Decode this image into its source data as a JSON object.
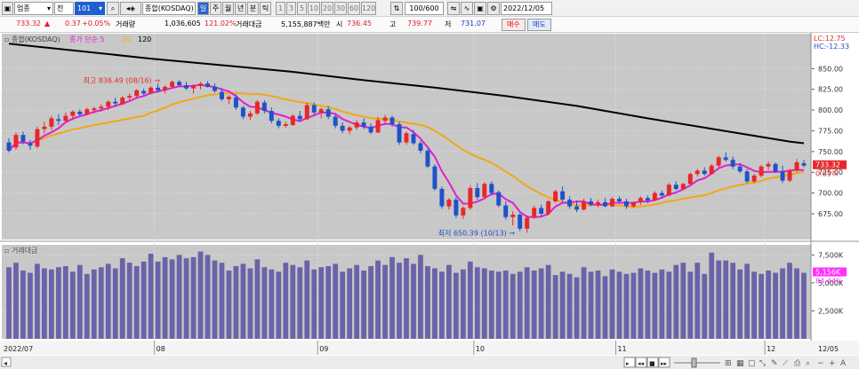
{
  "toolbar": {
    "market_type": "업종",
    "period_prefix": "전",
    "code": "101",
    "search_icon": "magnifier-icon",
    "index_name": "종합(KOSDAQ)",
    "periods": [
      "일",
      "주",
      "월",
      "년",
      "분",
      "틱"
    ],
    "selected_period": "일",
    "intervals": [
      "1",
      "3",
      "5",
      "10",
      "20",
      "30",
      "60",
      "120"
    ],
    "count": "100/600",
    "date": "2022/12/05"
  },
  "quote": {
    "price": "733.32",
    "change_arrow": "▲",
    "change": "0.37",
    "change_pct": "+0.05%",
    "volume_label": "거래량",
    "volume": "1,036,605",
    "volume_pct": "121.02%",
    "value_label": "거래대금",
    "value": "5,155,887백만",
    "open_label": "시",
    "open": "736.45",
    "high_label": "고",
    "high": "739.77",
    "low_label": "저",
    "low": "731.07",
    "buy_label": "매수",
    "sell_label": "매도"
  },
  "legend": {
    "main_title": "종합(KOSDAQ)",
    "ma_label": "종가 단순",
    "ma5": "5",
    "ma20": "20",
    "ma120": "120",
    "volume_title": "거래대금"
  },
  "annotations": {
    "high_label": "최고 836.49 (08/16)",
    "low_label": "최저 650.39 (10/13)",
    "lc": "LC:12.75",
    "hc": "HC:-12.33",
    "price_tag": "733.32",
    "price_tag_pct": "0.05%",
    "vol_tag": "5,156K",
    "vol_tag_pct": "84.44%"
  },
  "colors": {
    "up": "#e8272a",
    "down": "#1f52c8",
    "ma5": "#e020d0",
    "ma20": "#f0a818",
    "ma120": "#000000",
    "volume_bar": "#6a63a8",
    "panel_bg": "#c8c8c8"
  },
  "x_axis": {
    "labels": [
      {
        "text": "2022/07",
        "index": 0
      },
      {
        "text": "08",
        "index": 21
      },
      {
        "text": "09",
        "index": 44
      },
      {
        "text": "10",
        "index": 66
      },
      {
        "text": "11",
        "index": 86
      },
      {
        "text": "12",
        "index": 107
      },
      {
        "text": "12/05",
        "index": 112
      }
    ]
  },
  "chart_data": {
    "type": "candlestick",
    "price_axis": {
      "ticks": [
        850,
        825,
        800,
        775,
        750,
        725,
        700,
        675
      ],
      "ylim": [
        644,
        892
      ]
    },
    "volume_axis": {
      "ticks": [
        "7,500K",
        "5,000K",
        "2,500K"
      ],
      "tick_values": [
        7500,
        5000,
        2500
      ],
      "ylim": [
        0,
        8400
      ]
    },
    "ma120_points": [
      [
        0,
        880
      ],
      [
        10,
        871
      ],
      [
        20,
        862
      ],
      [
        30,
        854
      ],
      [
        40,
        846
      ],
      [
        50,
        836
      ],
      [
        60,
        827
      ],
      [
        70,
        817
      ],
      [
        80,
        805
      ],
      [
        90,
        790
      ],
      [
        100,
        776
      ],
      [
        110,
        762
      ],
      [
        112,
        760
      ]
    ],
    "candles": [
      [
        0,
        761,
        766,
        749,
        751
      ],
      [
        1,
        755,
        773,
        752,
        770
      ],
      [
        2,
        770,
        774,
        759,
        762
      ],
      [
        3,
        760,
        764,
        752,
        757
      ],
      [
        4,
        756,
        780,
        754,
        777
      ],
      [
        5,
        777,
        786,
        772,
        780
      ],
      [
        6,
        780,
        793,
        776,
        790
      ],
      [
        7,
        789,
        795,
        782,
        787
      ],
      [
        8,
        787,
        797,
        784,
        793
      ],
      [
        9,
        793,
        800,
        788,
        798
      ],
      [
        10,
        798,
        801,
        793,
        795
      ],
      [
        11,
        795,
        803,
        794,
        801
      ],
      [
        12,
        800,
        804,
        796,
        802
      ],
      [
        13,
        802,
        807,
        798,
        804
      ],
      [
        14,
        804,
        812,
        800,
        810
      ],
      [
        15,
        810,
        815,
        805,
        808
      ],
      [
        16,
        807,
        817,
        806,
        815
      ],
      [
        17,
        815,
        820,
        812,
        817
      ],
      [
        18,
        817,
        825,
        814,
        824
      ],
      [
        19,
        823,
        826,
        818,
        820
      ],
      [
        20,
        820,
        829,
        819,
        827
      ],
      [
        21,
        827,
        832,
        821,
        824
      ],
      [
        22,
        824,
        830,
        820,
        828
      ],
      [
        23,
        828,
        836,
        826,
        834
      ],
      [
        24,
        834,
        836,
        828,
        830
      ],
      [
        25,
        830,
        834,
        824,
        826
      ],
      [
        26,
        826,
        831,
        820,
        829
      ],
      [
        27,
        829,
        834,
        825,
        832
      ],
      [
        28,
        832,
        835,
        827,
        828
      ],
      [
        29,
        828,
        832,
        821,
        823
      ],
      [
        30,
        822,
        826,
        811,
        813
      ],
      [
        31,
        813,
        818,
        807,
        816
      ],
      [
        32,
        815,
        819,
        800,
        803
      ],
      [
        33,
        803,
        805,
        789,
        792
      ],
      [
        34,
        792,
        799,
        788,
        796
      ],
      [
        35,
        796,
        812,
        794,
        810
      ],
      [
        36,
        809,
        812,
        796,
        799
      ],
      [
        37,
        799,
        803,
        784,
        787
      ],
      [
        38,
        787,
        790,
        778,
        781
      ],
      [
        39,
        781,
        786,
        779,
        783
      ],
      [
        40,
        782,
        795,
        781,
        793
      ],
      [
        41,
        793,
        799,
        786,
        789
      ],
      [
        42,
        789,
        809,
        788,
        806
      ],
      [
        43,
        806,
        809,
        794,
        797
      ],
      [
        44,
        797,
        803,
        790,
        801
      ],
      [
        45,
        801,
        805,
        789,
        792
      ],
      [
        46,
        792,
        795,
        778,
        781
      ],
      [
        47,
        781,
        785,
        772,
        775
      ],
      [
        48,
        775,
        781,
        771,
        779
      ],
      [
        49,
        779,
        788,
        776,
        785
      ],
      [
        50,
        785,
        790,
        777,
        780
      ],
      [
        51,
        780,
        784,
        771,
        773
      ],
      [
        52,
        773,
        792,
        772,
        788
      ],
      [
        53,
        787,
        794,
        783,
        791
      ],
      [
        54,
        791,
        793,
        780,
        783
      ],
      [
        55,
        783,
        786,
        758,
        761
      ],
      [
        56,
        761,
        774,
        758,
        772
      ],
      [
        57,
        771,
        776,
        758,
        760
      ],
      [
        58,
        760,
        763,
        748,
        751
      ],
      [
        59,
        751,
        753,
        730,
        732
      ],
      [
        60,
        732,
        735,
        703,
        705
      ],
      [
        61,
        705,
        708,
        681,
        684
      ],
      [
        62,
        684,
        694,
        680,
        692
      ],
      [
        63,
        692,
        695,
        670,
        673
      ],
      [
        64,
        673,
        684,
        669,
        682
      ],
      [
        65,
        682,
        709,
        680,
        706
      ],
      [
        66,
        706,
        712,
        692,
        695
      ],
      [
        67,
        695,
        713,
        694,
        711
      ],
      [
        68,
        711,
        714,
        697,
        700
      ],
      [
        69,
        701,
        703,
        683,
        685
      ],
      [
        70,
        685,
        690,
        668,
        671
      ],
      [
        71,
        671,
        678,
        661,
        674
      ],
      [
        72,
        674,
        676,
        654,
        657
      ],
      [
        73,
        657,
        673,
        652,
        670
      ],
      [
        74,
        671,
        685,
        669,
        682
      ],
      [
        75,
        682,
        686,
        672,
        675
      ],
      [
        76,
        675,
        692,
        673,
        690
      ],
      [
        77,
        690,
        704,
        688,
        702
      ],
      [
        78,
        702,
        708,
        689,
        692
      ],
      [
        79,
        692,
        696,
        681,
        684
      ],
      [
        80,
        684,
        691,
        677,
        680
      ],
      [
        81,
        680,
        693,
        679,
        690
      ],
      [
        82,
        690,
        694,
        684,
        686
      ],
      [
        83,
        686,
        692,
        683,
        689
      ],
      [
        84,
        689,
        694,
        683,
        684
      ],
      [
        85,
        684,
        695,
        683,
        693
      ],
      [
        86,
        693,
        696,
        688,
        690
      ],
      [
        87,
        690,
        693,
        681,
        684
      ],
      [
        88,
        684,
        690,
        682,
        689
      ],
      [
        89,
        689,
        696,
        686,
        694
      ],
      [
        90,
        694,
        697,
        688,
        691
      ],
      [
        91,
        691,
        702,
        690,
        700
      ],
      [
        92,
        700,
        703,
        695,
        697
      ],
      [
        93,
        697,
        712,
        696,
        710
      ],
      [
        94,
        710,
        714,
        703,
        705
      ],
      [
        95,
        705,
        712,
        704,
        711
      ],
      [
        96,
        711,
        725,
        710,
        723
      ],
      [
        97,
        723,
        729,
        720,
        727
      ],
      [
        98,
        727,
        731,
        721,
        723
      ],
      [
        99,
        723,
        735,
        722,
        733
      ],
      [
        100,
        733,
        745,
        731,
        743
      ],
      [
        101,
        743,
        749,
        738,
        740
      ],
      [
        102,
        740,
        744,
        729,
        732
      ],
      [
        103,
        732,
        736,
        724,
        726
      ],
      [
        104,
        726,
        729,
        712,
        714
      ],
      [
        105,
        714,
        723,
        712,
        721
      ],
      [
        106,
        721,
        734,
        719,
        732
      ],
      [
        107,
        732,
        738,
        728,
        735
      ],
      [
        108,
        735,
        737,
        724,
        726
      ],
      [
        109,
        726,
        733,
        712,
        715
      ],
      [
        110,
        715,
        729,
        713,
        727
      ],
      [
        111,
        727,
        741,
        725,
        737
      ],
      [
        112,
        736,
        740,
        731,
        733
      ]
    ],
    "volumes": [
      6400,
      6800,
      6100,
      5900,
      6700,
      6300,
      6200,
      6400,
      6500,
      6000,
      6600,
      5800,
      6200,
      6400,
      6700,
      6300,
      7200,
      6800,
      6500,
      6900,
      7600,
      6900,
      7300,
      7100,
      7500,
      7200,
      7300,
      7800,
      7500,
      7000,
      6800,
      6100,
      6500,
      6700,
      6300,
      7100,
      6400,
      6200,
      6000,
      6800,
      6600,
      6400,
      7000,
      6200,
      6400,
      6500,
      6700,
      6000,
      6300,
      6600,
      6100,
      6500,
      7000,
      6600,
      7300,
      6800,
      7200,
      6700,
      7500,
      6500,
      6300,
      6000,
      6600,
      5900,
      6200,
      6900,
      6400,
      6300,
      6100,
      6000,
      6100,
      5800,
      6000,
      6400,
      6100,
      6300,
      6600,
      5700,
      6000,
      5800,
      5500,
      6400,
      6000,
      6100,
      5600,
      6200,
      6000,
      5800,
      5900,
      6300,
      6100,
      5900,
      6200,
      6000,
      6600,
      6800,
      6000,
      6800,
      5800,
      7700,
      7000,
      7000,
      6800,
      6200,
      6700,
      6000,
      5800,
      6100,
      5900,
      6300,
      6800,
      6300,
      5900
    ]
  }
}
